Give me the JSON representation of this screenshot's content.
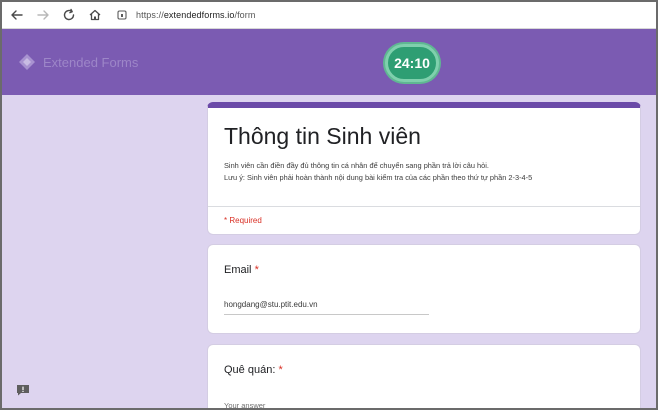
{
  "browser": {
    "url_prefix": "https://",
    "url_host": "extendedforms.io",
    "url_path": "/form"
  },
  "header": {
    "brand_name": "Extended Forms",
    "timer": "24:10"
  },
  "form": {
    "title": "Thông tin Sinh viên",
    "description_line1": "Sinh viên cần điền đầy đủ thông tin cá nhân để chuyển sang phần trả lời câu hỏi.",
    "description_line2": "Lưu ý: Sinh viên phải hoàn thành nội dung bài kiểm tra của các phần theo thứ tự phần 2-3-4-5",
    "required_note": "* Required"
  },
  "questions": [
    {
      "label": "Email",
      "required_mark": "*",
      "answer": "hongdang@stu.ptit.edu.vn"
    },
    {
      "label": "Quê quán:",
      "required_mark": "*",
      "placeholder": "Your answer"
    }
  ],
  "colors": {
    "header": "#7b5bb2",
    "background": "#ddd4ef",
    "timer": "#2e9e73",
    "required": "#d93025"
  },
  "icons": {
    "back": "arrow-left-icon",
    "forward": "arrow-right-icon",
    "reload": "reload-icon",
    "home": "home-icon",
    "site_info": "site-info-icon",
    "brand": "extended-forms-logo-icon",
    "feedback": "feedback-icon"
  }
}
